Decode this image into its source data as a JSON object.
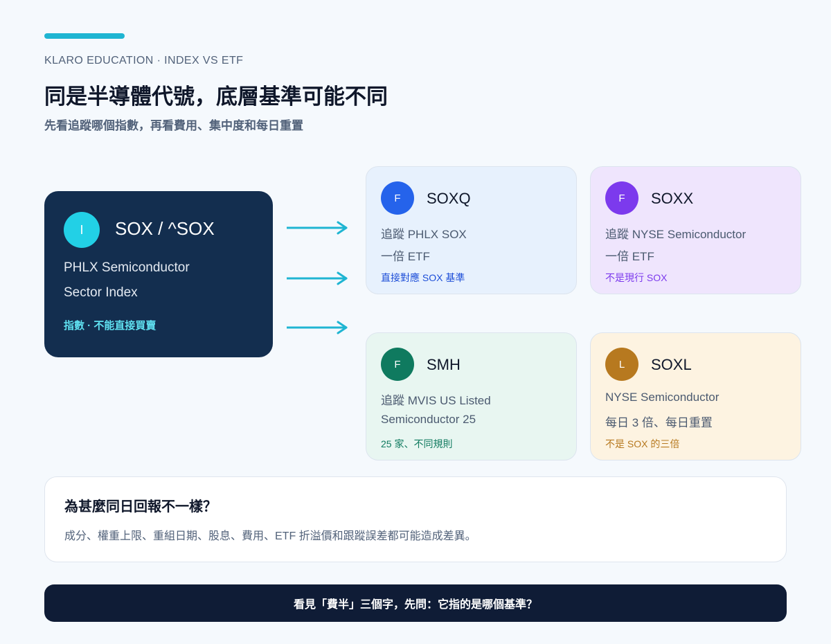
{
  "header": {
    "eyebrow": "KLARO EDUCATION · INDEX VS ETF",
    "title": "同是半導體代號，底層基準可能不同",
    "subtitle": "先看追蹤哪個指數，再看費用、集中度和每日重置"
  },
  "index_card": {
    "badge": "I",
    "title": "SOX / ^SOX",
    "line1": "PHLX Semiconductor",
    "line2": "Sector Index",
    "note": "指數 · 不能直接買賣"
  },
  "etfs": [
    {
      "badge": "F",
      "ticker": "SOXQ",
      "line1": "追蹤 PHLX SOX",
      "line2": "一倍 ETF",
      "note": "直接對應 SOX 基準",
      "badge_color": "#2563eb",
      "note_color": "#1d4ed8"
    },
    {
      "badge": "F",
      "ticker": "SOXX",
      "line1": "追蹤 NYSE Semiconductor",
      "line2": "一倍 ETF",
      "note": "不是現行 SOX",
      "badge_color": "#7c3aed",
      "note_color": "#7c3aed"
    },
    {
      "badge": "F",
      "ticker": "SMH",
      "line1": "追蹤 MVIS US Listed",
      "line2": "Semiconductor 25",
      "note": "25 家、不同規則",
      "badge_color": "#0f7a5f",
      "note_color": "#0f7a5f"
    },
    {
      "badge": "L",
      "ticker": "SOXL",
      "line1": "NYSE Semiconductor",
      "line2": "每日 3 倍、每日重置",
      "note": "不是 SOX 的三倍",
      "badge_color": "#b7791f",
      "note_color": "#b7791f"
    }
  ],
  "why": {
    "title": "為甚麼同日回報不一樣？",
    "text": "成分、權重上限、重組日期、股息、費用、ETF 折溢價和跟蹤誤差都可能造成差異。"
  },
  "footer": {
    "text": "看見「費半」三個字，先問：它指的是哪個基準？"
  },
  "colors": {
    "accent": "#1fb5d2",
    "index_card_bg": "#132e4f",
    "footer_bg": "#0f1c36"
  }
}
